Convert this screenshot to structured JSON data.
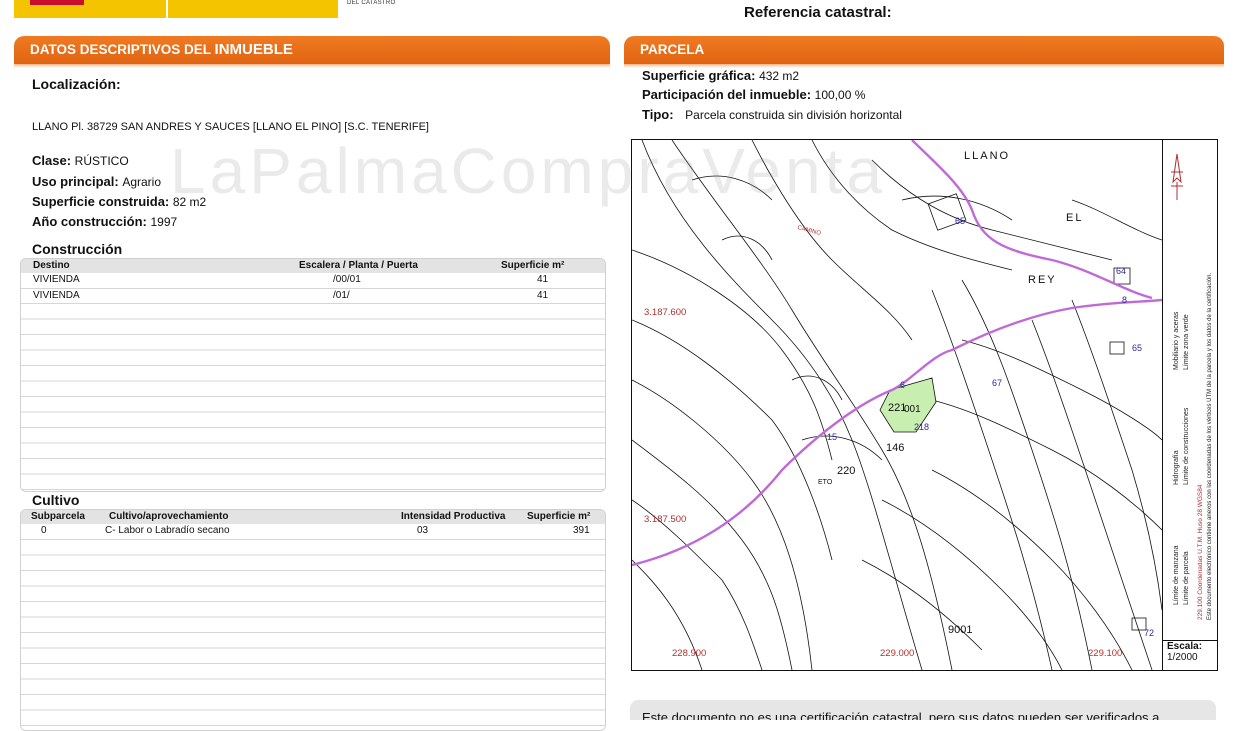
{
  "header": {
    "logo_small_text": "DEL CATASTRO",
    "ref_catastral_label": "Referencia catastral:"
  },
  "watermark": "LaPalmaCompraVenta",
  "left_panel": {
    "title_prefix": "DATOS DESCRIPTIVOS DEL ",
    "title_emph": "INMUEBLE",
    "localizacion_label": "Localización:",
    "localizacion_value": "LLANO Pl. 38729 SAN ANDRES Y SAUCES [LLANO EL PINO] [S.C. TENERIFE]",
    "clase_label": "Clase:",
    "clase_value": "RÚSTICO",
    "uso_label": "Uso principal:",
    "uso_value": "Agrario",
    "superficie_label": "Superficie construida:",
    "superficie_value": "82 m2",
    "anio_label": "Año construcción:",
    "anio_value": "1997",
    "construccion": {
      "title": "Construcción",
      "headers": [
        "Destino",
        "Escalera / Planta / Puerta",
        "Superficie m²"
      ],
      "rows": [
        [
          "VIVIENDA",
          "/00/01",
          "41"
        ],
        [
          "VIVIENDA",
          "/01/",
          "41"
        ]
      ]
    },
    "cultivo": {
      "title": "Cultivo",
      "headers": [
        "Subparcela",
        "Cultivo/aprovechamiento",
        "Intensidad Productiva",
        "Superficie m²"
      ],
      "rows": [
        [
          "0",
          "C- Labor o Labradío secano",
          "03",
          "391"
        ]
      ]
    }
  },
  "right_panel": {
    "title": "PARCELA",
    "sup_grafica_label": "Superficie gráfica:",
    "sup_grafica_value": "432 m2",
    "participacion_label": "Participación del inmueble:",
    "participacion_value": "100,00 %",
    "tipo_label": "Tipo:",
    "tipo_value": "Parcela construida sin división horizontal",
    "map": {
      "place_labels": [
        "LLANO",
        "EL",
        "REY",
        "CAMINO"
      ],
      "coord_y": [
        "3.187.600",
        "3.187.500"
      ],
      "coord_x": [
        "228.900",
        "229.000",
        "229.100"
      ],
      "parcel_labels": [
        "65",
        "64",
        "8",
        "65",
        "67",
        "15",
        "220",
        "146",
        "221",
        "001",
        "218",
        "ETO",
        "9001",
        "72",
        "6"
      ],
      "escala_label": "Escala:",
      "escala_value": "1/2000",
      "legend": [
        "Límite de manzana",
        "Límite de parcela",
        "Hidrografía",
        "Límite de construcciones",
        "Mobiliario y aceras",
        "Límite zona verde"
      ],
      "coords_note": "229.100 Coordenadas U.T.M. Huso 28 WGS84",
      "electronic_note": "Este documento electrónico contiene anexos con las coordenadas de los vértices UTM de la parcela y los datos de la certificación.",
      "colors": {
        "road": "#c06ad8",
        "green_area": "#c8efb0",
        "coords": "#b03030",
        "parcel_numbers": "#2a2aa0"
      }
    },
    "bottom_note": "Este documento no es una certificación catastral, pero sus datos pueden ser verificados a"
  },
  "colors": {
    "header_orange": "#ec6c19",
    "logo_yellow": "#f5c400"
  }
}
